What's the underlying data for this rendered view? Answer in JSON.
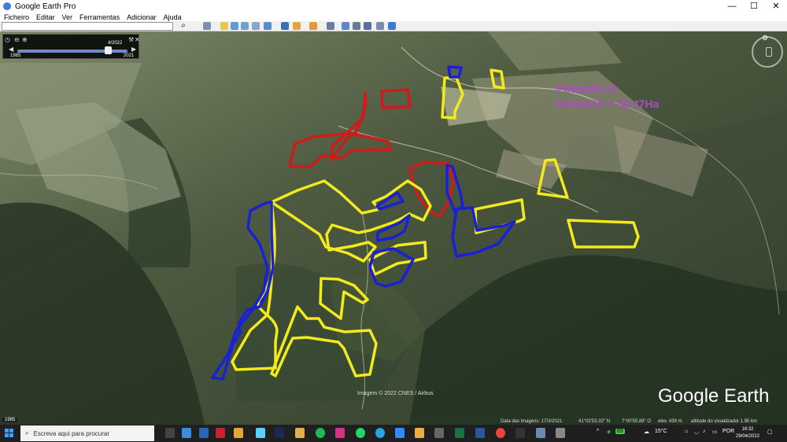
{
  "window": {
    "title": "Google Earth Pro",
    "minimize": "—",
    "maximize": "☐",
    "close": "✕"
  },
  "menu": [
    "Ficheiro",
    "Editar",
    "Ver",
    "Ferramentas",
    "Adicionar",
    "Ajuda"
  ],
  "search": {
    "value": "",
    "placeholder": ""
  },
  "time_slider": {
    "start_year": "1985",
    "end_year": "2021",
    "current_date": "4/2022",
    "position_fraction": 0.93
  },
  "overlay": {
    "line1": "PINHEIROS",
    "line2": "MANSOS = 48,47Ha"
  },
  "colors": {
    "red": "#d11a1a",
    "yellow": "#f3ea1c",
    "blue": "#1820d8",
    "label_purple": "#b04ac8"
  },
  "map": {
    "imagery_credit": "Imagem © 2022 CNES / Airbus",
    "brand": "Google Earth",
    "historical_year": "1985",
    "status": {
      "imagery_date": "Data das imagens: 17/3/2021",
      "lat": "41°02'53.32\" N",
      "lon": "7°00'55.88\" O",
      "elev": "elev.  439 m",
      "eye_alt": "altitude do visualizador   1.95 km"
    }
  },
  "taskbar": {
    "search_placeholder": "Escreva aqui para procurar",
    "temperature": "15°C",
    "language": "POR",
    "time": "16:32",
    "date": "29/04/2022",
    "battery": "69"
  }
}
